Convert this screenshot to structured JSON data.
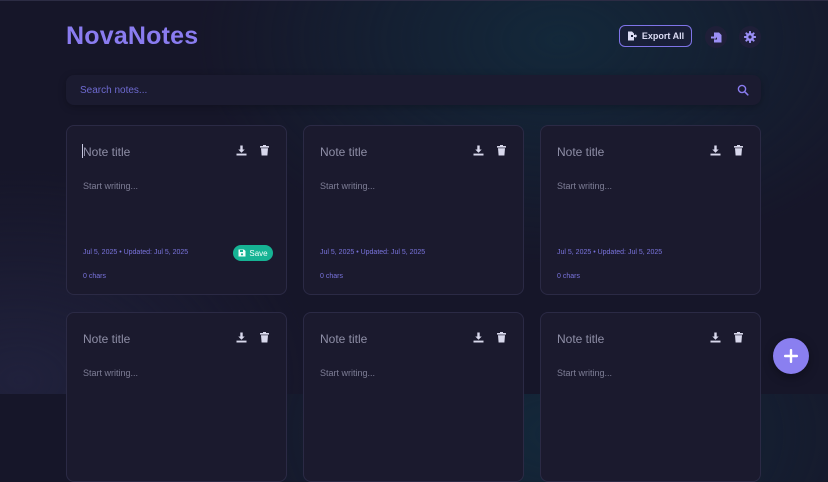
{
  "app": {
    "name": "NovaNotes"
  },
  "toolbar": {
    "export_label": "Export All",
    "export_icon": "file-export-icon",
    "import_icon": "file-import-icon",
    "settings_icon": "gear-icon",
    "accent": "#8a7cf0"
  },
  "search": {
    "placeholder": "Search notes...",
    "value": "",
    "icon": "search-icon"
  },
  "notes": [
    {
      "title_placeholder": "Note title",
      "body_placeholder": "Start writing...",
      "dates": "Jul 5, 2025 • Updated: Jul 5, 2025",
      "chars": "0 chars",
      "save_label": "Save",
      "focused": true
    },
    {
      "title_placeholder": "Note title",
      "body_placeholder": "Start writing...",
      "dates": "Jul 5, 2025 • Updated: Jul 5, 2025",
      "chars": "0 chars"
    },
    {
      "title_placeholder": "Note title",
      "body_placeholder": "Start writing...",
      "dates": "Jul 5, 2025 • Updated: Jul 5, 2025",
      "chars": "0 chars"
    },
    {
      "title_placeholder": "Note title",
      "body_placeholder": "Start writing..."
    },
    {
      "title_placeholder": "Note title",
      "body_placeholder": "Start writing..."
    },
    {
      "title_placeholder": "Note title",
      "body_placeholder": "Start writing..."
    }
  ],
  "card_icons": {
    "download": "download-icon",
    "delete": "trash-icon"
  },
  "fab": {
    "icon": "plus-icon"
  },
  "colors": {
    "background": "#161629",
    "card": "#1b1a2e",
    "save": "#16b394",
    "meta_text": "#7a74de"
  }
}
